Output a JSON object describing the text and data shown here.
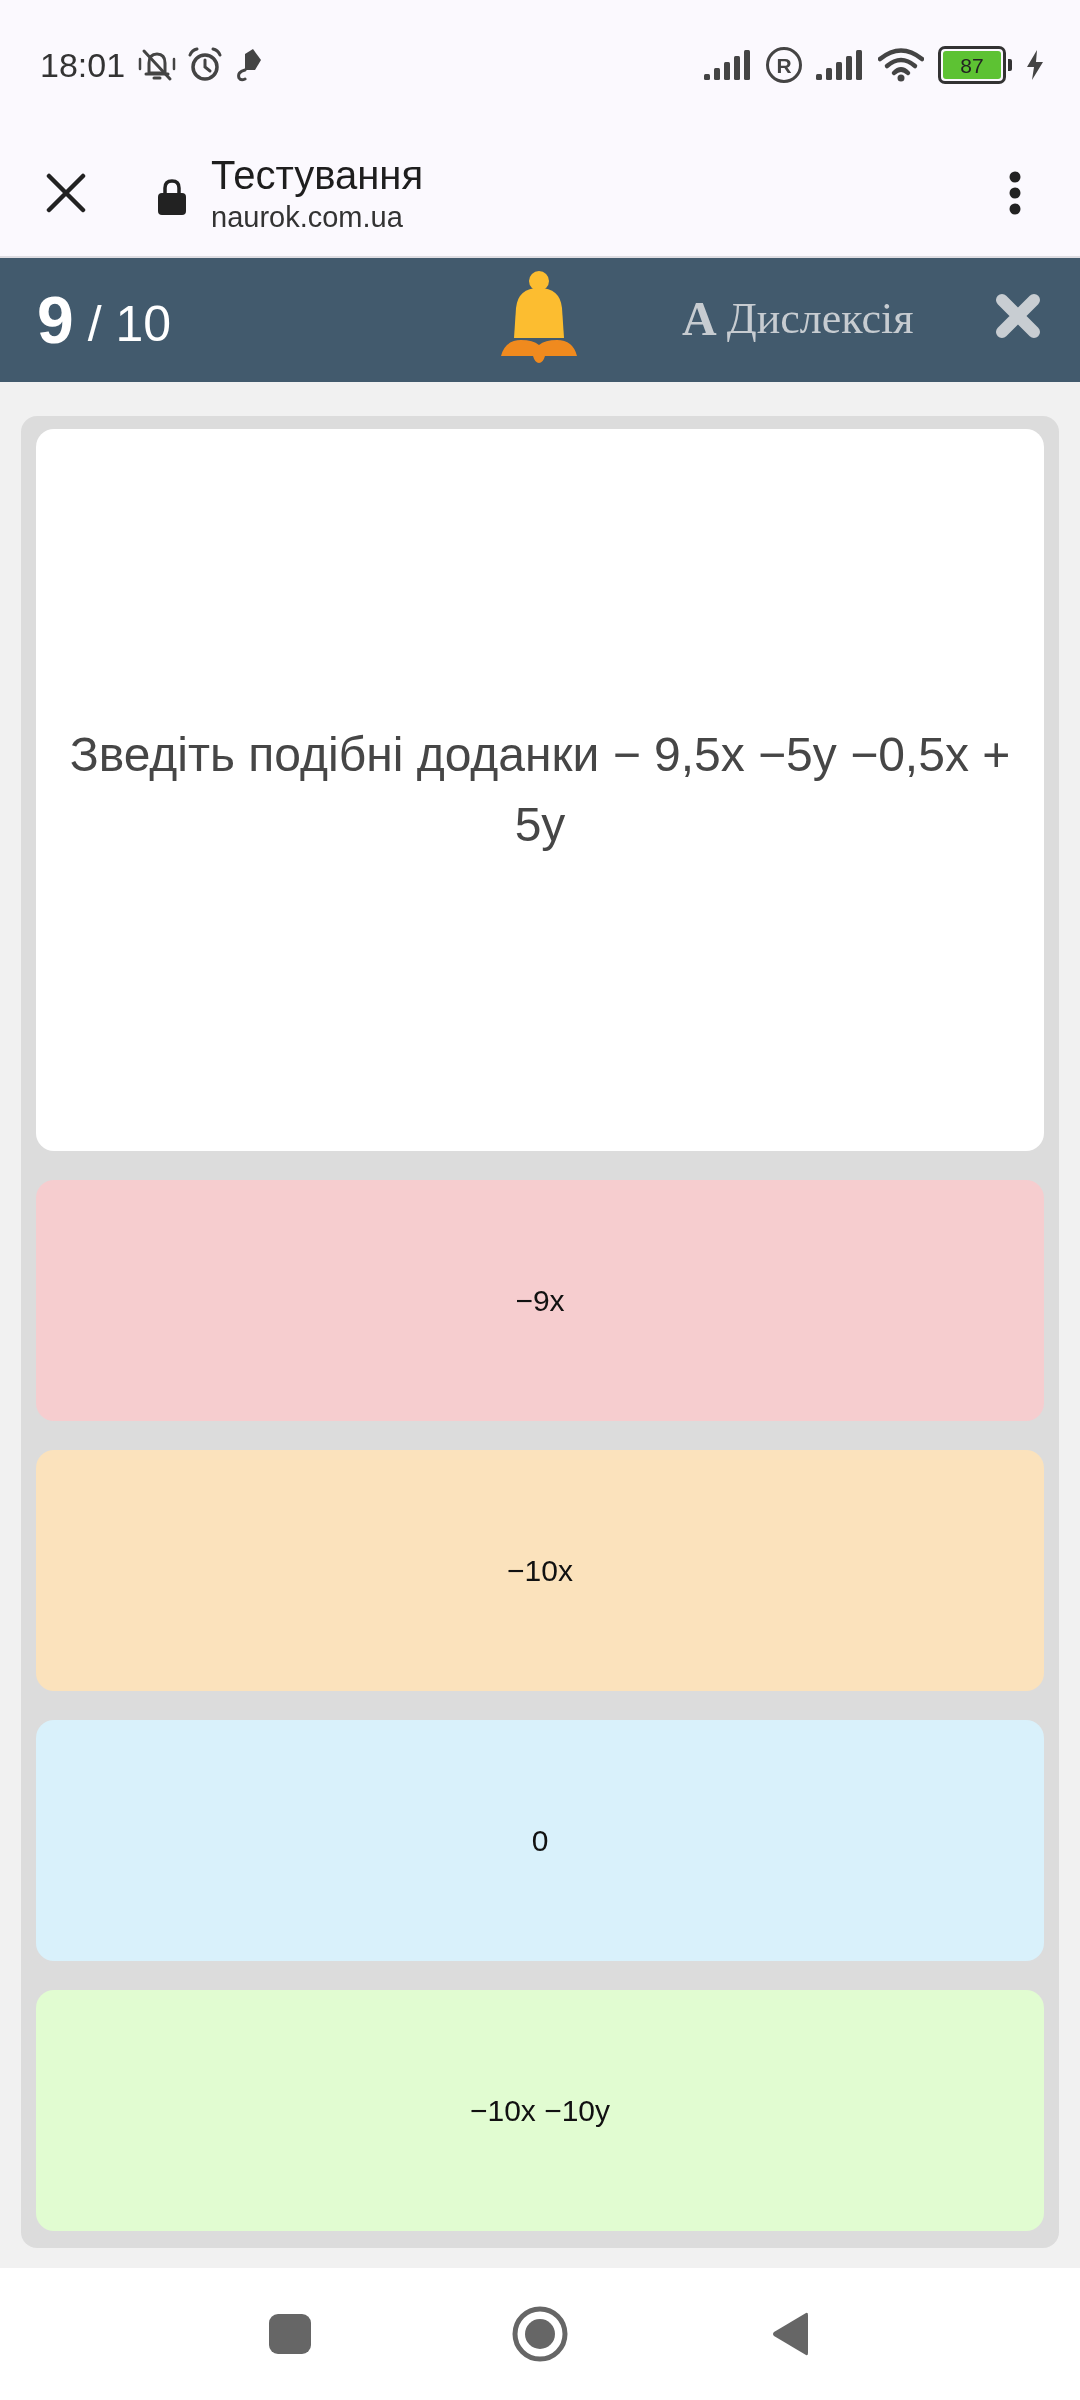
{
  "status_bar": {
    "time": "18:01",
    "roaming_mark": "R",
    "battery": "87"
  },
  "browser_bar": {
    "title": "Тестування",
    "url": "naurok.com.ua"
  },
  "quiz_header": {
    "current": "9",
    "total": "/ 10",
    "dyslexia_glyph": "A",
    "dyslexia_label": "Дислексія"
  },
  "question": {
    "text": "Зведіть подібні доданки − 9,5x −5y −0,5x + 5y"
  },
  "answers": [
    {
      "text": "−9x",
      "color": "#f6cdcf"
    },
    {
      "text": "−10x",
      "color": "#fbe2bc"
    },
    {
      "text": "0",
      "color": "#d9f1fb"
    },
    {
      "text": "−10x −10y",
      "color": "#e1fcd1"
    }
  ]
}
